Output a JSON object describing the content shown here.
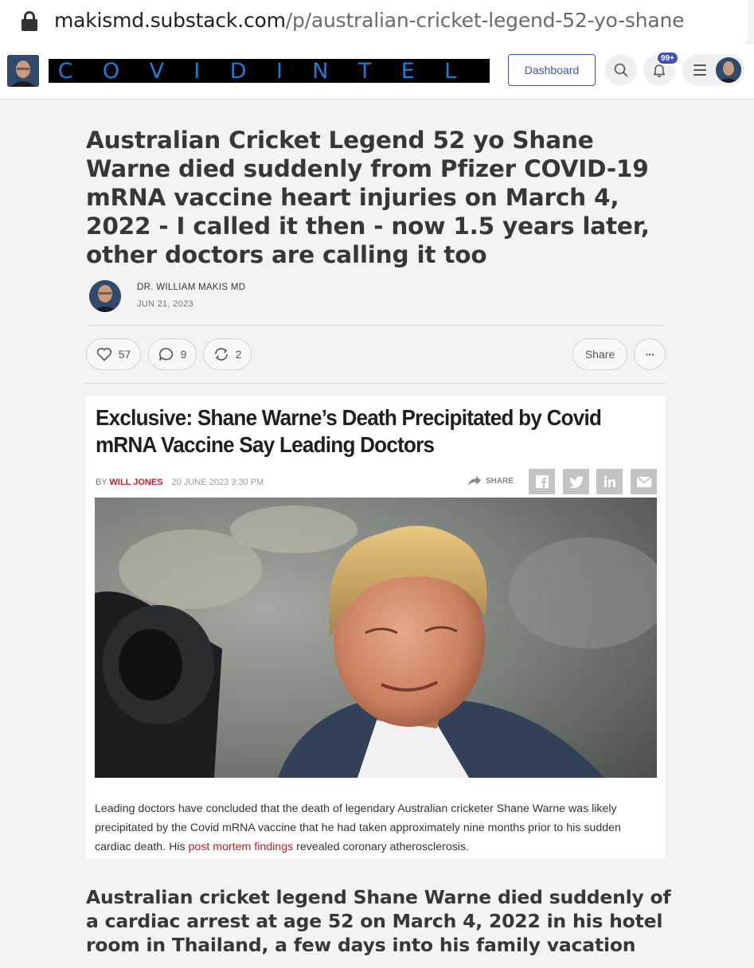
{
  "browser": {
    "url_host": "makismd.substack.com",
    "url_path": "/p/australian-cricket-legend-52-yo-shane"
  },
  "header": {
    "publication_name": "COVID INTEL",
    "logo_letters_left": [
      "C",
      "O",
      "V",
      "I",
      "D"
    ],
    "logo_letters_right": [
      "I",
      "N",
      "T",
      "E",
      "L"
    ],
    "dashboard_label": "Dashboard",
    "notification_badge": "99+",
    "accent_color": "#3f51b5"
  },
  "post": {
    "title": "Australian Cricket Legend 52 yo Shane Warne died suddenly from Pfizer COVID-19 mRNA vaccine heart injuries on March 4, 2022 - I called it then - now 1.5 years later, other doctors are calling it too",
    "author": "DR. WILLIAM MAKIS MD",
    "date": "JUN 21, 2023",
    "likes": "57",
    "comments": "9",
    "restacks": "2",
    "share_label": "Share",
    "more_label": "···"
  },
  "embed": {
    "title": "Exclusive: Shane Warne’s Death Precipitated by Covid mRNA Vaccine Say Leading Doctors",
    "by": "BY",
    "author": "WILL JONES",
    "date": "20 JUNE 2023 3:30 PM",
    "share_label": "SHARE",
    "social": [
      "f",
      "t",
      "in",
      "mail"
    ],
    "body_before_link": "Leading doctors have concluded that the death of legendary Australian cricketer Shane Warne was likely precipitated by the Covid mRNA vaccine that he had taken approximately nine months prior to his sudden cardiac death. His ",
    "body_link": "post mortem findings",
    "body_after_link": " revealed coronary atherosclerosis.",
    "link_color": "#c41d26"
  },
  "sub_heading": "Australian cricket legend Shane Warne died suddenly of a cardiac arrest at age 52 on March 4, 2022 in his hotel room in Thailand, a few days into his family vacation"
}
